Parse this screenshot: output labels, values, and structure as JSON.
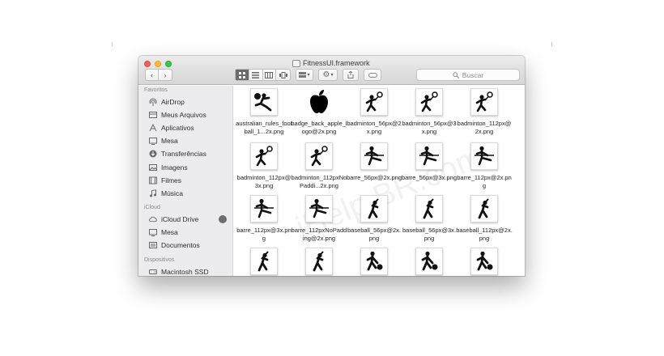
{
  "window": {
    "title": "FitnessUI.framework"
  },
  "toolbar": {
    "search_placeholder": "Buscar"
  },
  "sidebar": {
    "sections": [
      {
        "title": "Favoritos",
        "items": [
          {
            "label": "AirDrop",
            "icon": "airdrop-icon"
          },
          {
            "label": "Meus Arquivos",
            "icon": "all-files-icon"
          },
          {
            "label": "Aplicativos",
            "icon": "applications-icon"
          },
          {
            "label": "Mesa",
            "icon": "desktop-icon"
          },
          {
            "label": "Transferências",
            "icon": "downloads-icon"
          },
          {
            "label": "Imagens",
            "icon": "pictures-icon"
          },
          {
            "label": "Filmes",
            "icon": "movies-icon"
          },
          {
            "label": "Música",
            "icon": "music-icon"
          }
        ]
      },
      {
        "title": "iCloud",
        "items": [
          {
            "label": "iCloud Drive",
            "icon": "cloud-icon"
          },
          {
            "label": "Mesa",
            "icon": "desktop-icon"
          },
          {
            "label": "Documentos",
            "icon": "documents-icon"
          }
        ]
      },
      {
        "title": "Dispositivos",
        "items": [
          {
            "label": "Macintosh SSD",
            "icon": "disk-icon"
          }
        ]
      }
    ]
  },
  "files": [
    {
      "name": "australian_rules_football_1...2x.png",
      "icon": "football-kick-icon"
    },
    {
      "name": "badge_back_apple_logo@2x.png",
      "icon": "apple-logo-icon"
    },
    {
      "name": "badminton_56px@2x.png",
      "icon": "badminton-icon"
    },
    {
      "name": "badminton_56px@3x.png",
      "icon": "badminton-icon"
    },
    {
      "name": "badminton_112px@2x.png",
      "icon": "badminton-icon"
    },
    {
      "name": "badminton_112px@3x.png",
      "icon": "badminton-icon"
    },
    {
      "name": "badminton_112pxNoPaddi...2x.png",
      "icon": "badminton-icon"
    },
    {
      "name": "barre_56px@2x.png",
      "icon": "barre-icon"
    },
    {
      "name": "barre_56px@3x.png",
      "icon": "barre-icon"
    },
    {
      "name": "barre_112px@2x.png",
      "icon": "barre-icon"
    },
    {
      "name": "barre_112px@3x.png",
      "icon": "barre-icon"
    },
    {
      "name": "barre_112pxNoPadding@2x.png",
      "icon": "barre-icon"
    },
    {
      "name": "baseball_56px@2x.png",
      "icon": "baseball-icon"
    },
    {
      "name": "baseball_56px@3x.png",
      "icon": "baseball-icon"
    },
    {
      "name": "baseball_112px@2x.png",
      "icon": "baseball-icon"
    },
    {
      "name": "",
      "icon": "baseball-icon"
    },
    {
      "name": "",
      "icon": "baseball-icon"
    },
    {
      "name": "",
      "icon": "basketball-icon"
    },
    {
      "name": "",
      "icon": "basketball-icon"
    },
    {
      "name": "",
      "icon": "basketball-icon"
    }
  ]
}
